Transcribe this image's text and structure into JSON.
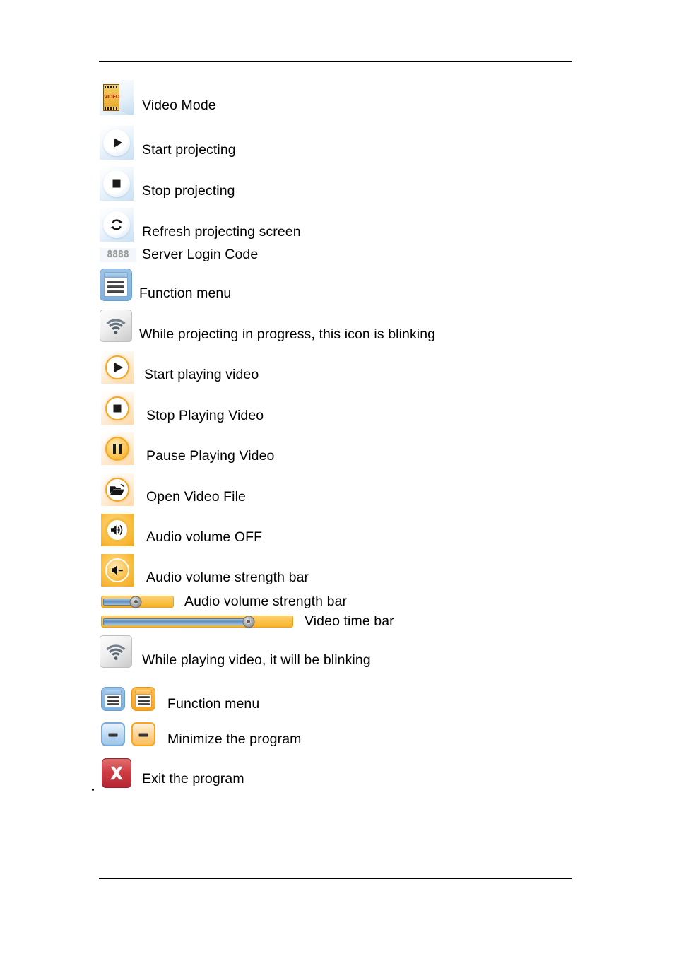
{
  "document": {
    "type": "manual-page",
    "background_color": "#ffffff",
    "rule_color": "#000000",
    "text_color": "#000000"
  },
  "legend": {
    "title": "",
    "rows": [
      {
        "id": "video-mode",
        "icon": "video-mode-filmstrip-icon",
        "icon_text": "VIDEO",
        "label": "Video Mode"
      },
      {
        "id": "start-projecting",
        "icon": "play-blue-circle-icon",
        "label": "Start projecting"
      },
      {
        "id": "stop-projecting",
        "icon": "stop-blue-circle-icon",
        "label": "Stop projecting"
      },
      {
        "id": "refresh-projecting-screen",
        "icon": "refresh-blue-circle-icon",
        "label": "Refresh projecting screen"
      },
      {
        "id": "server-login-code",
        "icon": "seven-segment-code-icon",
        "icon_text": "8888",
        "label": "Server Login Code"
      },
      {
        "id": "function-menu-blue",
        "icon": "function-menu-blue-icon",
        "label": "Function menu"
      },
      {
        "id": "projecting-blinking",
        "icon": "wifi-signal-gray-icon",
        "label": "While projecting in progress, this icon is blinking"
      },
      {
        "id": "start-playing-video",
        "icon": "play-orange-circle-icon",
        "label": "Start playing video"
      },
      {
        "id": "stop-playing-video",
        "icon": "stop-orange-circle-icon",
        "label": "Stop Playing Video"
      },
      {
        "id": "pause-playing-video",
        "icon": "pause-orange-circle-icon",
        "label": "Pause Playing Video"
      },
      {
        "id": "open-video-file",
        "icon": "open-folder-orange-circle-icon",
        "label": "Open Video File"
      },
      {
        "id": "audio-volume-off",
        "icon": "speaker-on-orange-circle-icon",
        "label": "Audio volume OFF"
      },
      {
        "id": "audio-volume-strength-icon",
        "icon": "speaker-minus-orange-circle-icon",
        "label": "Audio volume strength bar"
      },
      {
        "id": "audio-volume-strength-bar",
        "icon": "audio-volume-slider",
        "label": "Audio volume strength bar"
      },
      {
        "id": "video-time-bar",
        "icon": "video-time-slider",
        "label": "Video time bar"
      },
      {
        "id": "playing-blinking",
        "icon": "wifi-signal-gray-icon",
        "label": "While playing video, it will be blinking"
      },
      {
        "id": "function-menu-pair",
        "icon": "function-menu-blue-icon",
        "icon_2": "function-menu-orange-icon",
        "label": "Function menu"
      },
      {
        "id": "minimize-program",
        "icon": "minimize-blue-icon",
        "icon_2": "minimize-orange-icon",
        "label": "Minimize the program"
      },
      {
        "id": "exit-program",
        "icon": "exit-red-x-icon",
        "label": "Exit the program"
      }
    ]
  },
  "sliders": {
    "audio_volume": {
      "name": "audio-volume-slider",
      "value_percent": 48,
      "track_color": "#f8b326",
      "fill_color": "#5f8fc0",
      "knob_color": "#8f8f8f"
    },
    "video_time": {
      "name": "video-time-slider",
      "value_percent": 77,
      "track_color": "#f8b326",
      "fill_color": "#5f8fc0",
      "knob_color": "#8f8f8f"
    }
  },
  "colors": {
    "blue_icon": "#7fb0dd",
    "orange_icon": "#f5a623",
    "exit_red": "#cf3b42",
    "code_gray": "#9a9a9a"
  }
}
